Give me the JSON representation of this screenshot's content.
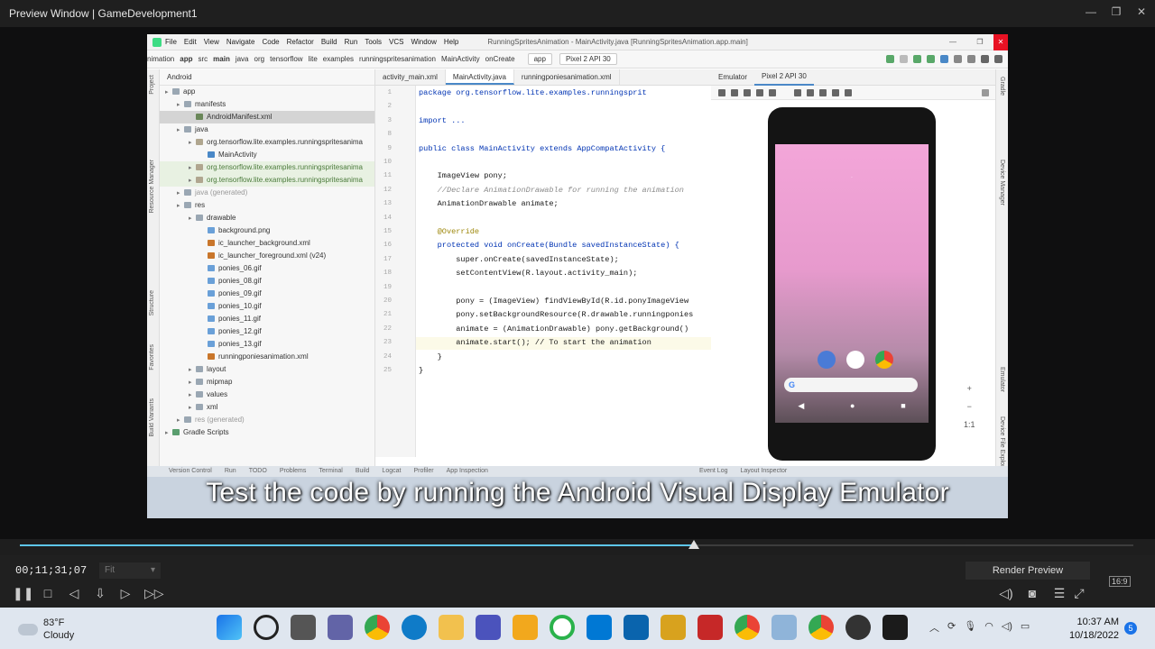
{
  "window": {
    "title": "Preview Window | GameDevelopment1"
  },
  "ide": {
    "menu": [
      "File",
      "Edit",
      "View",
      "Navigate",
      "Code",
      "Refactor",
      "Build",
      "Run",
      "Tools",
      "VCS",
      "Window",
      "Help"
    ],
    "project_title": "RunningSpritesAnimation - MainActivity.java [RunningSpritesAnimation.app.main]",
    "breadcrumb": [
      "nimation",
      "app",
      "src",
      "main",
      "java",
      "org",
      "tensorflow",
      "lite",
      "examples",
      "runningspritesanimation",
      "MainActivity",
      "onCreate"
    ],
    "run_config": "app",
    "device": "Pixel 2 API 30",
    "project_view": "Android",
    "tabs": [
      "activity_main.xml",
      "MainActivity.java",
      "runningponiesanimation.xml"
    ],
    "active_tab": "MainActivity.java",
    "emulator_tabs": [
      "Emulator",
      "Pixel 2 API 30"
    ],
    "tree": [
      {
        "label": "app",
        "depth": 0,
        "kind": "folder"
      },
      {
        "label": "manifests",
        "depth": 1,
        "kind": "folder"
      },
      {
        "label": "AndroidManifest.xml",
        "depth": 2,
        "kind": "file",
        "selected": true
      },
      {
        "label": "java",
        "depth": 1,
        "kind": "folder"
      },
      {
        "label": "org.tensorflow.lite.examples.runningspritesanima",
        "depth": 2,
        "kind": "package"
      },
      {
        "label": "MainActivity",
        "depth": 3,
        "kind": "class"
      },
      {
        "label": "org.tensorflow.lite.examples.runningspritesanima",
        "depth": 2,
        "kind": "package",
        "highlight": true
      },
      {
        "label": "org.tensorflow.lite.examples.runningspritesanima",
        "depth": 2,
        "kind": "package",
        "highlight": true
      },
      {
        "label": "java (generated)",
        "depth": 1,
        "kind": "folder",
        "muted": true
      },
      {
        "label": "res",
        "depth": 1,
        "kind": "folder"
      },
      {
        "label": "drawable",
        "depth": 2,
        "kind": "folder"
      },
      {
        "label": "background.png",
        "depth": 3,
        "kind": "image"
      },
      {
        "label": "ic_launcher_background.xml",
        "depth": 3,
        "kind": "xml"
      },
      {
        "label": "ic_launcher_foreground.xml (v24)",
        "depth": 3,
        "kind": "xml"
      },
      {
        "label": "ponies_06.gif",
        "depth": 3,
        "kind": "image"
      },
      {
        "label": "ponies_08.gif",
        "depth": 3,
        "kind": "image"
      },
      {
        "label": "ponies_09.gif",
        "depth": 3,
        "kind": "image"
      },
      {
        "label": "ponies_10.gif",
        "depth": 3,
        "kind": "image"
      },
      {
        "label": "ponies_11.gif",
        "depth": 3,
        "kind": "image"
      },
      {
        "label": "ponies_12.gif",
        "depth": 3,
        "kind": "image"
      },
      {
        "label": "ponies_13.gif",
        "depth": 3,
        "kind": "image"
      },
      {
        "label": "runningponiesanimation.xml",
        "depth": 3,
        "kind": "xml"
      },
      {
        "label": "layout",
        "depth": 2,
        "kind": "folder"
      },
      {
        "label": "mipmap",
        "depth": 2,
        "kind": "folder"
      },
      {
        "label": "values",
        "depth": 2,
        "kind": "folder"
      },
      {
        "label": "xml",
        "depth": 2,
        "kind": "folder"
      },
      {
        "label": "res (generated)",
        "depth": 1,
        "kind": "folder",
        "muted": true
      },
      {
        "label": "Gradle Scripts",
        "depth": 0,
        "kind": "gradle"
      }
    ],
    "code_lines": [
      {
        "n": "1",
        "text": "package org.tensorflow.lite.examples.runningsprit"
      },
      {
        "n": "2",
        "text": ""
      },
      {
        "n": "3",
        "text": "import ..."
      },
      {
        "n": "8",
        "text": ""
      },
      {
        "n": "9",
        "text": "public class MainActivity extends AppCompatActivity {"
      },
      {
        "n": "10",
        "text": ""
      },
      {
        "n": "11",
        "text": "    ImageView pony;"
      },
      {
        "n": "12",
        "text": "    //Declare AnimationDrawable for running the animation"
      },
      {
        "n": "13",
        "text": "    AnimationDrawable animate;"
      },
      {
        "n": "14",
        "text": ""
      },
      {
        "n": "15",
        "text": "    @Override"
      },
      {
        "n": "16",
        "text": "    protected void onCreate(Bundle savedInstanceState) {"
      },
      {
        "n": "17",
        "text": "        super.onCreate(savedInstanceState);"
      },
      {
        "n": "18",
        "text": "        setContentView(R.layout.activity_main);"
      },
      {
        "n": "19",
        "text": ""
      },
      {
        "n": "20",
        "text": "        pony = (ImageView) findViewById(R.id.ponyImageView"
      },
      {
        "n": "21",
        "text": "        pony.setBackgroundResource(R.drawable.runningponies"
      },
      {
        "n": "22",
        "text": "        animate = (AnimationDrawable) pony.getBackground()"
      },
      {
        "n": "23",
        "text": "        animate.start(); // To start the animation"
      },
      {
        "n": "24",
        "text": "    }"
      },
      {
        "n": "25",
        "text": "}"
      }
    ],
    "left_strip": [
      "Project",
      "Resource Manager",
      "Structure",
      "Favorites",
      "Build Variants"
    ],
    "right_strip": [
      "Gradle",
      "Device Manager",
      "Emulator",
      "Device File Explorer"
    ],
    "bottom_tools": [
      "Version Control",
      "Run",
      "TODO",
      "Problems",
      "Terminal",
      "Build",
      "Logcat",
      "Profiler",
      "App Inspection",
      "Event Log",
      "Layout Inspector"
    ],
    "zoom_controls": [
      "+",
      "−",
      "1:1"
    ]
  },
  "caption": "Test the code by running the Android  Visual Display Emulator",
  "player": {
    "timecode": "00;11;31;07",
    "fit": "Fit",
    "render_label": "Render Preview",
    "ratio": "16:9",
    "progress": 0.605
  },
  "taskbar": {
    "temp": "83°F",
    "weather": "Cloudy",
    "time": "10:37 AM",
    "date": "10/18/2022",
    "notifications": "5"
  }
}
